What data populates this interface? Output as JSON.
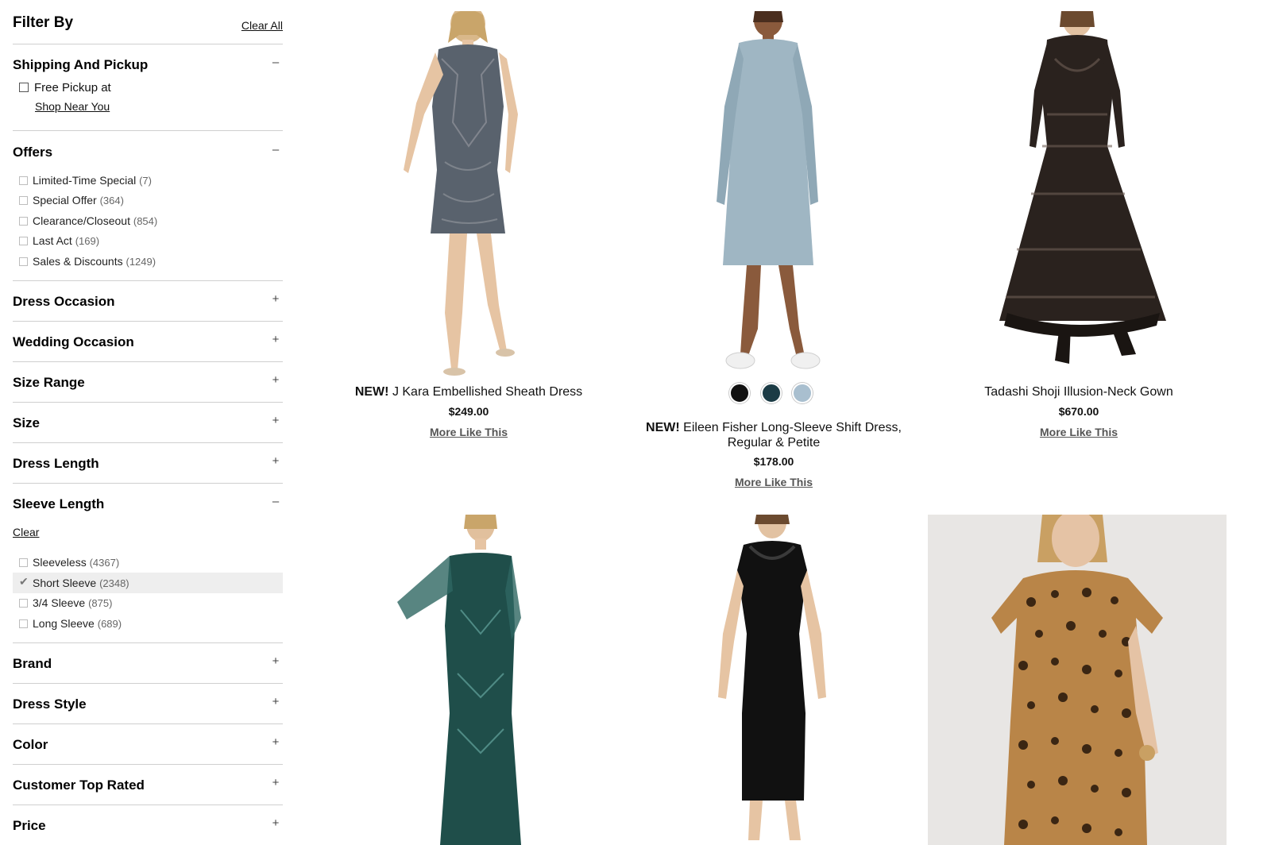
{
  "filters": {
    "title": "Filter By",
    "clear_all": "Clear All",
    "shipping": {
      "title": "Shipping And Pickup",
      "toggle": "–",
      "pickup_label": "Free Pickup at",
      "pickup_link": "Shop Near You"
    },
    "offers": {
      "title": "Offers",
      "toggle": "–",
      "items": [
        {
          "label": "Limited-Time Special",
          "count": "(7)"
        },
        {
          "label": "Special Offer",
          "count": "(364)"
        },
        {
          "label": "Clearance/Closeout",
          "count": "(854)"
        },
        {
          "label": "Last Act",
          "count": "(169)"
        },
        {
          "label": "Sales & Discounts",
          "count": "(1249)"
        }
      ]
    },
    "collapsed_top": [
      {
        "title": "Dress Occasion",
        "toggle": "+"
      },
      {
        "title": "Wedding Occasion",
        "toggle": "+"
      },
      {
        "title": "Size Range",
        "toggle": "+"
      },
      {
        "title": "Size",
        "toggle": "+"
      },
      {
        "title": "Dress Length",
        "toggle": "+"
      }
    ],
    "sleeve": {
      "title": "Sleeve Length",
      "toggle": "–",
      "clear": "Clear",
      "items": [
        {
          "label": "Sleeveless",
          "count": "(4367)",
          "checked": false
        },
        {
          "label": "Short Sleeve",
          "count": "(2348)",
          "checked": true
        },
        {
          "label": "3/4 Sleeve",
          "count": "(875)",
          "checked": false
        },
        {
          "label": "Long Sleeve",
          "count": "(689)",
          "checked": false
        }
      ]
    },
    "collapsed_bottom": [
      {
        "title": "Brand",
        "toggle": "+"
      },
      {
        "title": "Dress Style",
        "toggle": "+"
      },
      {
        "title": "Color",
        "toggle": "+"
      },
      {
        "title": "Customer Top Rated",
        "toggle": "+"
      },
      {
        "title": "Price",
        "toggle": "+"
      }
    ]
  },
  "products": [
    {
      "badge": "NEW!",
      "name": "J Kara Embellished Sheath Dress",
      "price": "$249.00",
      "more": "More Like This"
    },
    {
      "badge": "NEW!",
      "name": "Eileen Fisher Long-Sleeve Shift Dress,",
      "name2": "Regular & Petite",
      "price": "$178.00",
      "more": "More Like This",
      "swatches": [
        "#111111",
        "#1b3b45",
        "#a9bfcf"
      ]
    },
    {
      "badge": "",
      "name": "Tadashi Shoji Illusion-Neck Gown",
      "price": "$670.00",
      "more": "More Like This"
    }
  ],
  "icons": {
    "check": "checkmark-icon"
  }
}
